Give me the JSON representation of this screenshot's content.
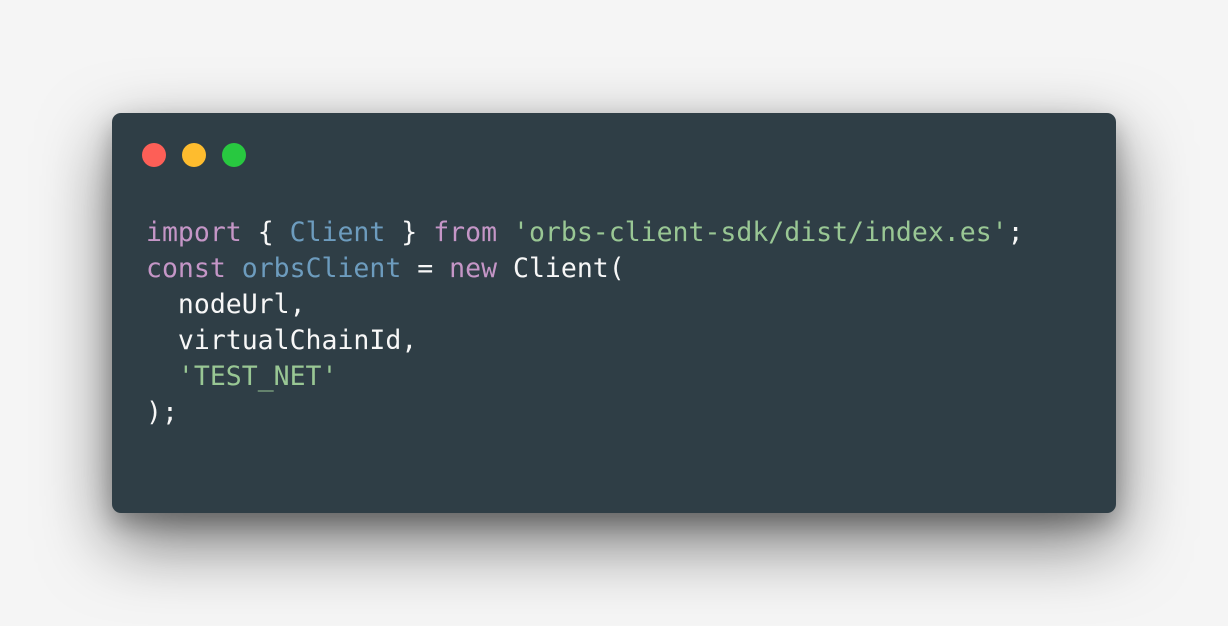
{
  "window": {
    "controls": [
      {
        "name": "close",
        "color": "#fd5f57"
      },
      {
        "name": "minimize",
        "color": "#febc2e"
      },
      {
        "name": "maximize",
        "color": "#28c840"
      }
    ]
  },
  "theme": {
    "background": "#2f3e46",
    "keyword": "#c596c7",
    "identifier": "#6d9cbe",
    "string": "#99c794",
    "plain": "#f7f7f7"
  },
  "code": {
    "lines": [
      {
        "t0": "import",
        "t1": " { ",
        "t2": "Client",
        "t3": " } ",
        "t4": "from",
        "t5": " ",
        "t6": "'orbs-client-sdk/dist/index.es'",
        "t7": ";"
      },
      {
        "t0": "const",
        "t1": " ",
        "t2": "orbsClient",
        "t3": " = ",
        "t4": "new",
        "t5": " Client("
      },
      {
        "t0": "  nodeUrl,"
      },
      {
        "t0": "  virtualChainId,"
      },
      {
        "t0": "  ",
        "t1": "'TEST_NET'"
      },
      {
        "t0": ");"
      }
    ]
  }
}
